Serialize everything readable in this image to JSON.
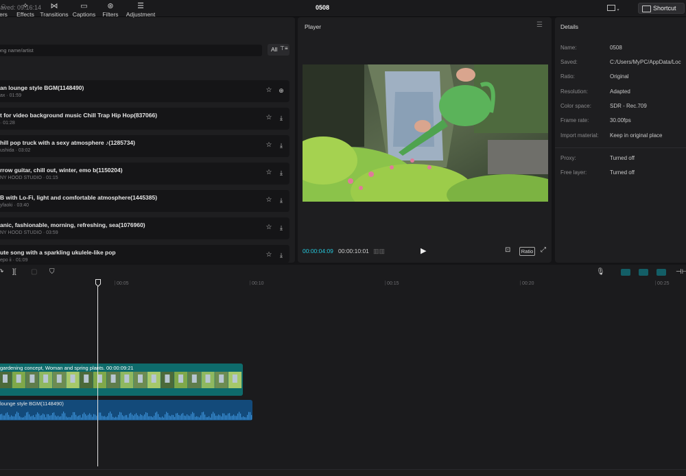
{
  "topbar": {
    "saved_text": "saved: 09:16:14",
    "project_title": "0508",
    "layout_icon": "layout-icon",
    "shortcut_label": "Shortcut"
  },
  "media_panel": {
    "tabs": [
      {
        "label": "Stickers",
        "display": "ers",
        "icon": "sticker-icon"
      },
      {
        "label": "Effects",
        "icon": "effects-icon"
      },
      {
        "label": "Transitions",
        "icon": "transitions-icon"
      },
      {
        "label": "Captions",
        "icon": "captions-icon"
      },
      {
        "label": "Filters",
        "icon": "filters-icon"
      },
      {
        "label": "Adjustment",
        "icon": "adjustment-icon"
      }
    ],
    "search_placeholder": "ong name/artist",
    "filter_label": "All",
    "items": [
      {
        "title": "an lounge style BGM(1148490)",
        "meta": "ax · 01:59",
        "action": "add"
      },
      {
        "title": "t for video background music Chill Trap Hip Hop(837066)",
        "meta": "· 01:28",
        "action": "download"
      },
      {
        "title": "hill pop truck with a sexy atmosphere ♪(1285734)",
        "meta": "ushida · 03:02",
        "action": "download"
      },
      {
        "title": "rrow guitar, chill out, winter, emo b(1150204)",
        "meta": "NY HOOD STUDIO · 01:15",
        "action": "download"
      },
      {
        "title": "B with Lo-Fi, light and comfortable atmosphere(1445385)",
        "meta": "yfaoki · 03:40",
        "action": "download"
      },
      {
        "title": "anic, fashionable, morning, refreshing, sea(1076960)",
        "meta": "NY HOOD STUDIO · 03:59",
        "action": "download"
      },
      {
        "title": "ute song with a sparkling ukulele-like pop",
        "meta": "epo ii · 01:09",
        "action": "download"
      }
    ]
  },
  "player": {
    "title": "Player",
    "current_time": "00:00:04:09",
    "total_time": "00:00:10:01",
    "ratio_label": "Ratio"
  },
  "details": {
    "title": "Details",
    "fields": [
      {
        "key": "Name:",
        "value": "0508"
      },
      {
        "key": "Saved:",
        "value": "C:/Users/MyPC/AppData/Loc"
      },
      {
        "key": "Ratio:",
        "value": "Original"
      },
      {
        "key": "Resolution:",
        "value": "Adapted"
      },
      {
        "key": "Color space:",
        "value": "SDR - Rec.709"
      },
      {
        "key": "Frame rate:",
        "value": "30.00fps"
      },
      {
        "key": "Import material:",
        "value": "Keep in original place"
      },
      {
        "key": "Proxy:",
        "value": "Turned off"
      },
      {
        "key": "Free layer:",
        "value": "Turned off"
      }
    ]
  },
  "timeline": {
    "ticks": [
      "00:05",
      "00:10",
      "00:15",
      "00:20",
      "00:25"
    ],
    "video_clip_label": "gardening concept, Woman and spring plants.  00:00:09:21",
    "audio_clip_label": "lounge style BGM(1148490)"
  },
  "colors": {
    "accent": "#26c6da",
    "video_clip": "#0e6b6b",
    "audio_clip": "#134a7a",
    "waveform": "#3a8fd6"
  }
}
